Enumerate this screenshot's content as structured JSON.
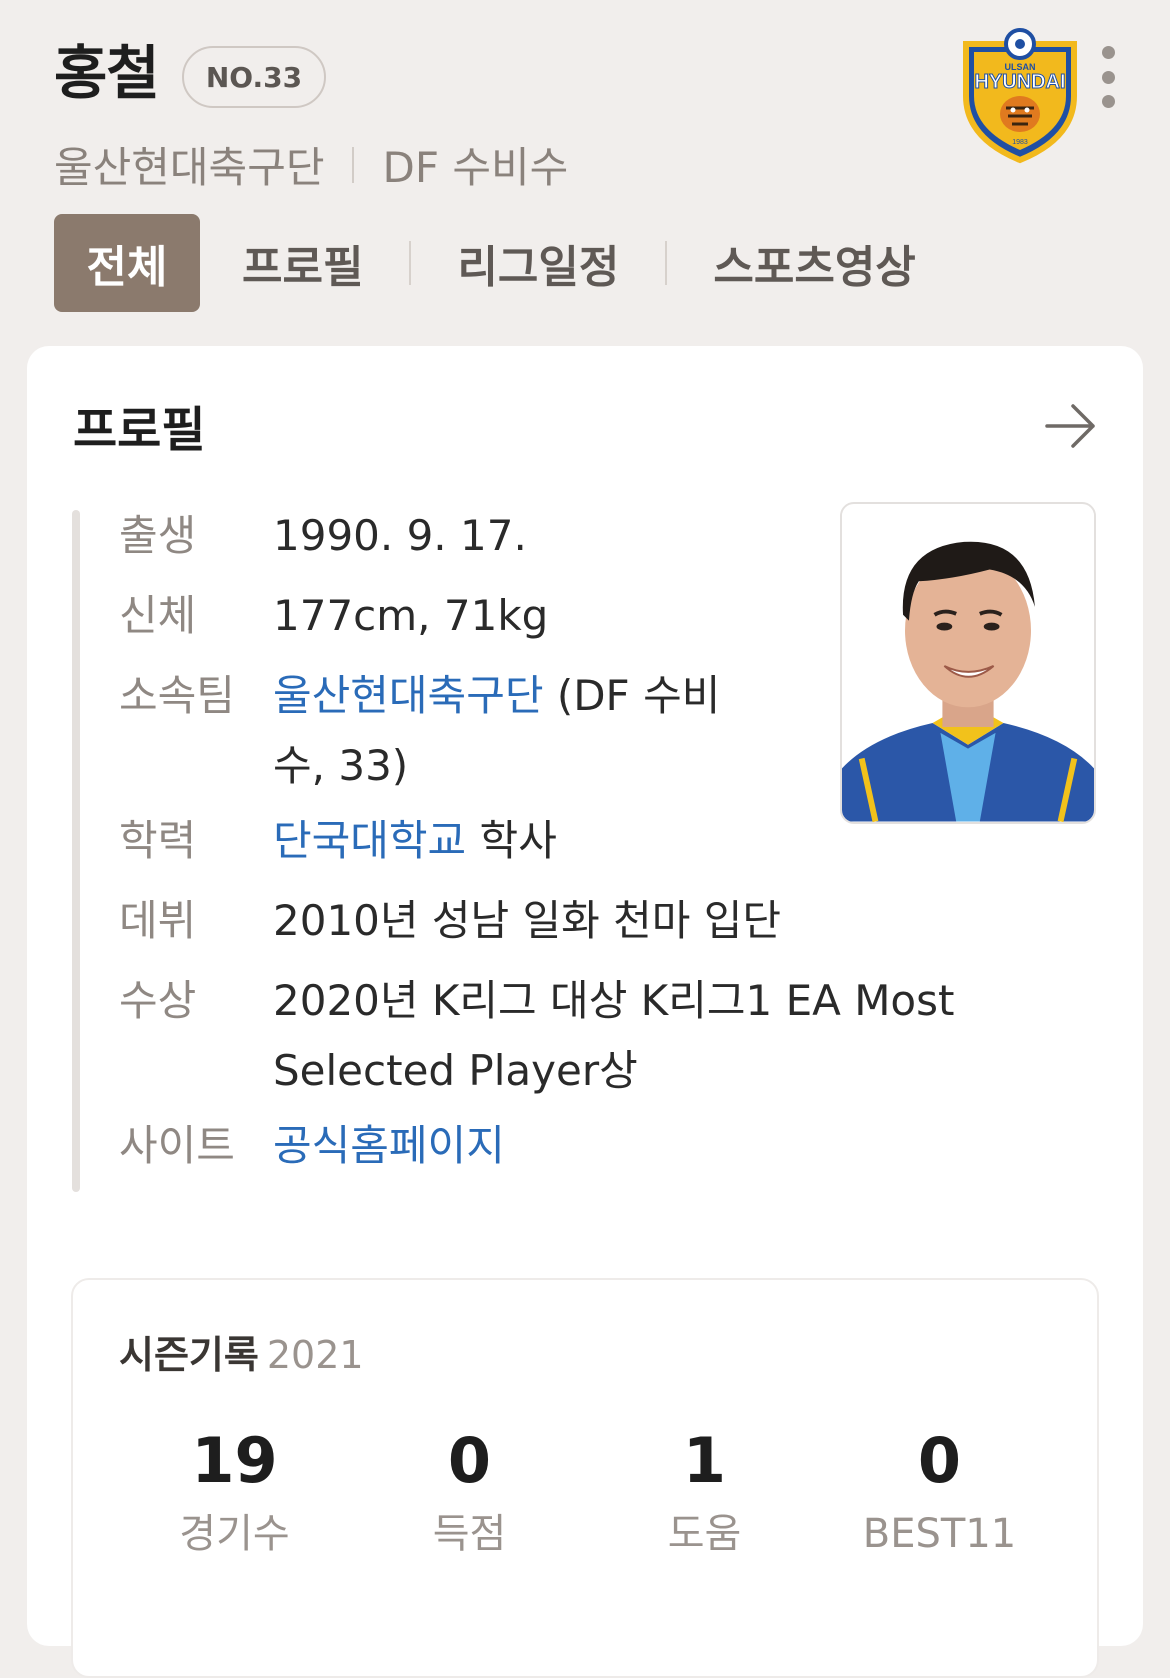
{
  "player": {
    "name": "홍철",
    "number": "NO.33",
    "team": "울산현대축구단",
    "position": "DF 수비수"
  },
  "logo": {
    "text": "HYUNDAI",
    "top_text": "ULSAN",
    "year": "1983"
  },
  "tabs": [
    "전체",
    "프로필",
    "리그일정",
    "스포츠영상"
  ],
  "profile": {
    "title": "프로필",
    "rows": {
      "birth": {
        "label": "출생",
        "value": "1990. 9. 17."
      },
      "body": {
        "label": "신체",
        "value": "177cm, 71kg"
      },
      "team": {
        "label": "소속팀",
        "link": "울산현대축구단",
        "rest": " (DF 수비수, 33)"
      },
      "edu": {
        "label": "학력",
        "link": "단국대학교",
        "rest": " 학사"
      },
      "debut": {
        "label": "데뷔",
        "value": "2010년 성남 일화 천마 입단"
      },
      "award": {
        "label": "수상",
        "value": "2020년 K리그 대상 K리그1 EA Most Selected Player상"
      },
      "site": {
        "label": "사이트",
        "link": "공식홈페이지"
      }
    }
  },
  "season": {
    "title": "시즌기록",
    "year": "2021",
    "stats": [
      {
        "value": "19",
        "label": "경기수"
      },
      {
        "value": "0",
        "label": "득점"
      },
      {
        "value": "1",
        "label": "도움"
      },
      {
        "value": "0",
        "label": "BEST11"
      }
    ]
  },
  "colors": {
    "accent": "#8b7a6d",
    "link": "#2a6bb8",
    "background": "#f1eeec"
  }
}
